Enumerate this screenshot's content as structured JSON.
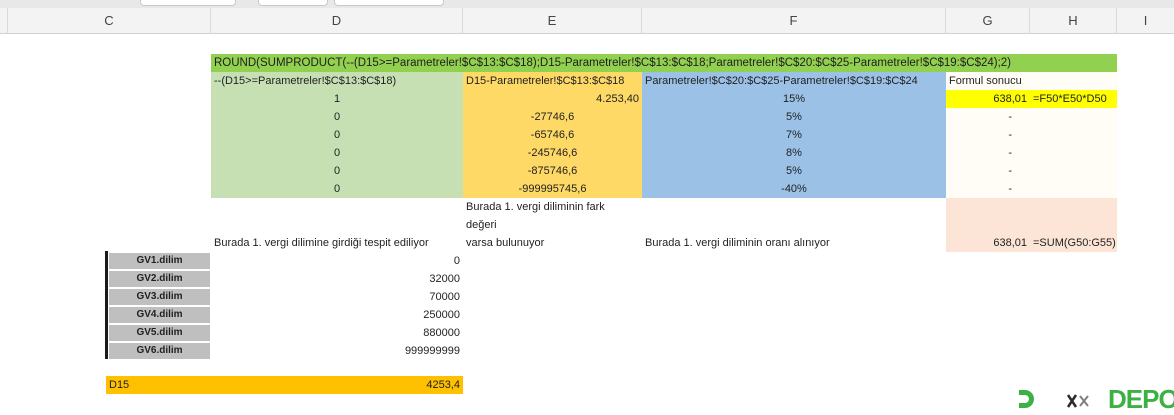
{
  "columns": [
    "C",
    "D",
    "E",
    "F",
    "G",
    "H",
    "I"
  ],
  "formula_banner": "ROUND(SUMPRODUCT(--(D15>=Parametreler!$C$13:$C$18);D15-Parametreler!$C$13:$C$18;Parametreler!$C$20:$C$25-Parametreler!$C$19:$C$24);2)",
  "headers": {
    "d": "--(D15>=Parametreler!$C$13:$C$18)",
    "e": "D15-Parametreler!$C$13:$C$18",
    "f": "Parametreler!$C$20:$C$25-Parametreler!$C$19:$C$24",
    "g": "Formul sonucu"
  },
  "rows": [
    {
      "d": "1",
      "e": "4.253,40",
      "f": "15%",
      "g": "638,01",
      "h": "=F50*E50*D50"
    },
    {
      "d": "0",
      "e": "-27746,6",
      "f": "5%",
      "g": "-"
    },
    {
      "d": "0",
      "e": "-65746,6",
      "f": "7%",
      "g": "-"
    },
    {
      "d": "0",
      "e": "-245746,6",
      "f": "8%",
      "g": "-"
    },
    {
      "d": "0",
      "e": "-875746,6",
      "f": "5%",
      "g": "-"
    },
    {
      "d": "0",
      "e": "-999995745,6",
      "f": "-40%",
      "g": "-"
    }
  ],
  "notes": {
    "e_line1": "Burada 1. vergi diliminin fark",
    "e_line2": "değeri",
    "e_line3": "varsa bulunuyor",
    "d": "Burada 1. vergi dilimine girdiği tespit ediliyor",
    "f": "Burada 1. vergi diliminin oranı alınıyor"
  },
  "total": {
    "value": "638,01",
    "formula": "=SUM(G50:G55)"
  },
  "brackets": [
    {
      "label": "GV1.dilim",
      "value": "0"
    },
    {
      "label": "GV2.dilim",
      "value": "32000"
    },
    {
      "label": "GV3.dilim",
      "value": "70000"
    },
    {
      "label": "GV4.dilim",
      "value": "250000"
    },
    {
      "label": "GV5.dilim",
      "value": "880000"
    },
    {
      "label": "GV6.dilim",
      "value": "999999999"
    }
  ],
  "d15": {
    "label": "D15",
    "value": "4253,4"
  },
  "logo_text": "DEPO",
  "colors": {
    "banner": "#92d050",
    "d_column": "#c6e0b4",
    "e_column": "#ffd966",
    "f_column": "#9bc2e6",
    "result": "#ffff00",
    "d15_bar": "#ffc000"
  }
}
